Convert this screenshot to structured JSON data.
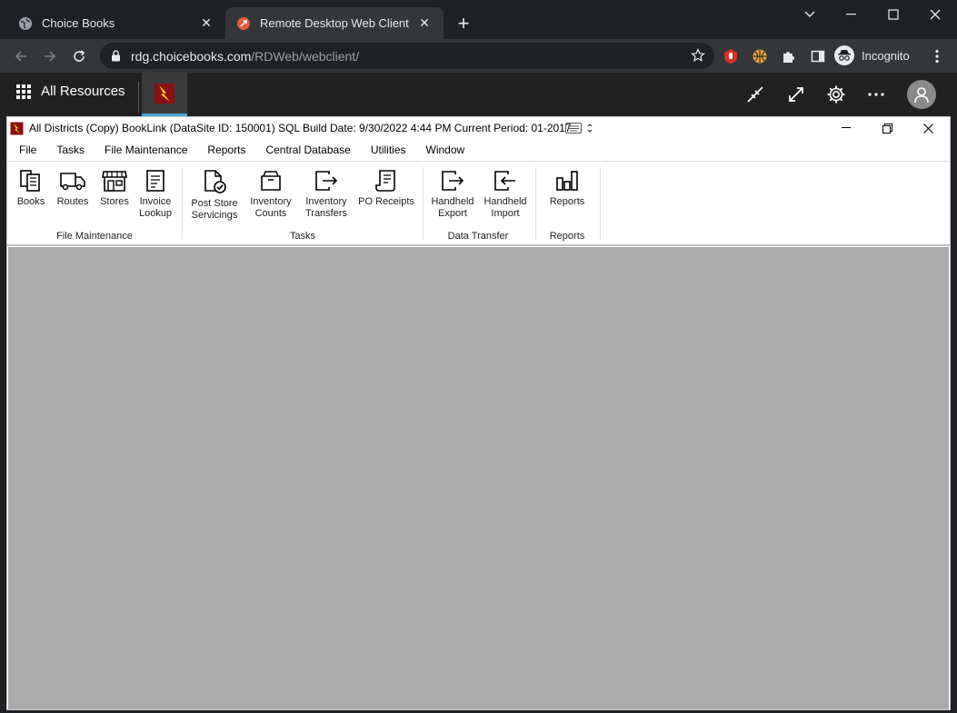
{
  "browser": {
    "tabs": [
      {
        "title": "Choice Books",
        "icon": "globe-icon"
      },
      {
        "title": "Remote Desktop Web Client",
        "icon": "rdweb-icon"
      }
    ],
    "url_host": "rdg.choicebooks.com",
    "url_path": "/RDWeb/webclient/",
    "profile_label": "Incognito"
  },
  "rd_header": {
    "all_resources_label": "All Resources"
  },
  "remote_app": {
    "title": "All Districts (Copy) BookLink (DataSite ID: 150001) SQL   Build Date: 9/30/2022 4:44 PM   Current Period: 01-2017",
    "menu": [
      "File",
      "Tasks",
      "File Maintenance",
      "Reports",
      "Central Database",
      "Utilities",
      "Window"
    ],
    "ribbon": {
      "file_maintenance": {
        "label": "File Maintenance",
        "buttons": [
          {
            "line1": "Books",
            "line2": ""
          },
          {
            "line1": "Routes",
            "line2": ""
          },
          {
            "line1": "Stores",
            "line2": ""
          },
          {
            "line1": "Invoice",
            "line2": "Lookup"
          }
        ]
      },
      "tasks": {
        "label": "Tasks",
        "buttons": [
          {
            "line1": "Post Store",
            "line2": "Servicings"
          },
          {
            "line1": "Inventory",
            "line2": "Counts"
          },
          {
            "line1": "Inventory",
            "line2": "Transfers"
          },
          {
            "line1": "PO Receipts",
            "line2": ""
          }
        ]
      },
      "data_transfer": {
        "label": "Data Transfer",
        "buttons": [
          {
            "line1": "Handheld",
            "line2": "Export"
          },
          {
            "line1": "Handheld",
            "line2": "Import"
          }
        ]
      },
      "reports": {
        "label": "Reports",
        "buttons": [
          {
            "line1": "Reports",
            "line2": ""
          }
        ]
      }
    }
  },
  "colors": {
    "chrome_dark": "#202124",
    "chrome_toolbar": "#35363a",
    "rd_header": "#212121",
    "workspace": "#ababab",
    "accent": "#4aa3df"
  }
}
